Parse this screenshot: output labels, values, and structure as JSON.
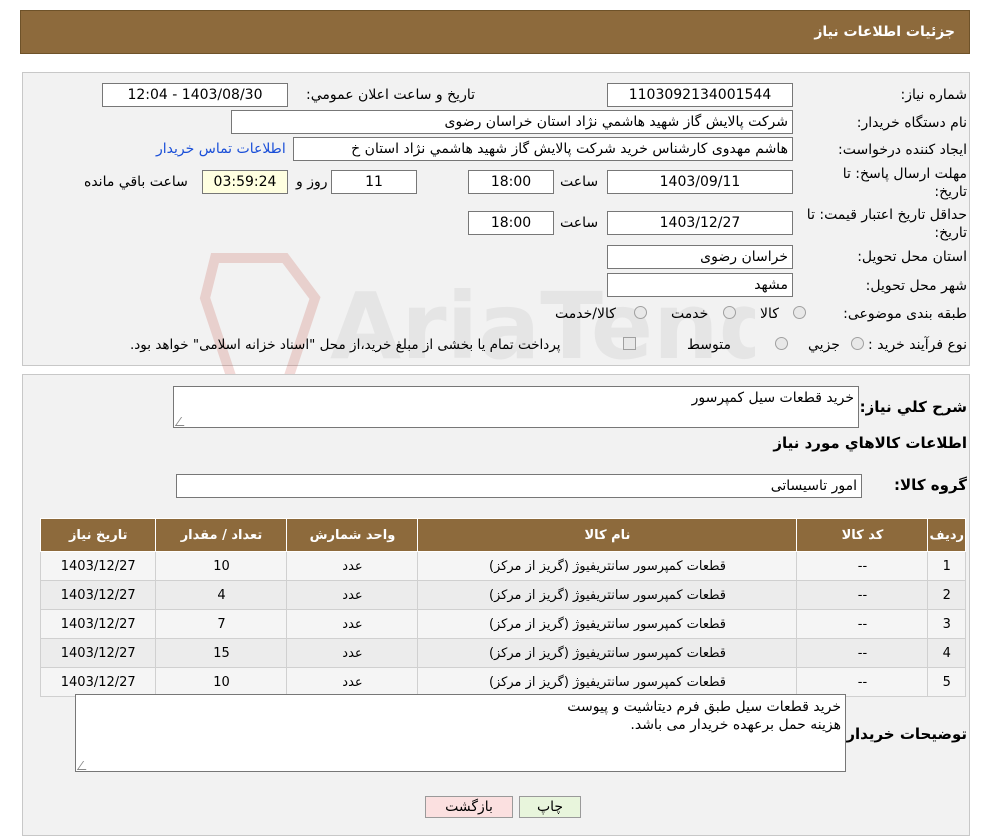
{
  "header": {
    "title": "جزئیات اطلاعات نیاز"
  },
  "form": {
    "need_number_label": "شماره نیاز:",
    "need_number": "1103092134001544",
    "announce_label": "تاریخ و ساعت اعلان عمومي:",
    "announce_value": "1403/08/30 - 12:04",
    "buyer_org_label": "نام دستگاه خريدار:",
    "buyer_org": "شرکت پالايش گاز شهيد هاشمي نژاد   استان خراسان رضوی",
    "creator_label": "ايجاد کننده درخواست:",
    "creator": "هاشم مهدوی کارشناس خرید شرکت پالايش گاز شهيد هاشمي نژاد   استان خ",
    "contact_link": "اطلاعات تماس خريدار",
    "deadline_label": "مهلت ارسال پاسخ: تا تاریخ:",
    "deadline_date": "1403/09/11",
    "time_label": "ساعت",
    "deadline_time": "18:00",
    "days_value": "11",
    "days_label": "روز و",
    "remaining_value": "03:59:24",
    "remaining_label": "ساعت باقي مانده",
    "validity_label": "حداقل تاريخ اعتبار قيمت: تا تاریخ:",
    "validity_date": "1403/12/27",
    "validity_time": "18:00",
    "province_label": "استان محل تحويل:",
    "province": "خراسان رضوی",
    "city_label": "شهر محل تحويل:",
    "city": "مشهد",
    "category_label": "طبقه بندی موضوعی:",
    "category_options": [
      "کالا",
      "خدمت",
      "کالا/خدمت"
    ],
    "purchase_type_label": "نوع فرآيند خريد :",
    "purchase_options": [
      "جزيي",
      "متوسط"
    ],
    "purchase_note": "پرداخت تمام يا بخشی از مبلغ خريد،از محل \"اسناد خزانه اسلامی\" خواهد بود."
  },
  "summary": {
    "label": "شرح کلي نياز:",
    "value": "خريد قطعات سيل کمپرسور"
  },
  "goods": {
    "section_title": "اطلاعات کالاهاي مورد نياز",
    "group_label": "گروه کالا:",
    "group_value": "امور تاسیساتی"
  },
  "table": {
    "headers": [
      "رديف",
      "کد کالا",
      "نام کالا",
      "واحد شمارش",
      "تعداد / مقدار",
      "تاريخ نياز"
    ],
    "rows": [
      [
        "1",
        "--",
        "قطعات کمپرسور سانتریفیوژ (گریز از مرکز)",
        "عدد",
        "10",
        "1403/12/27"
      ],
      [
        "2",
        "--",
        "قطعات کمپرسور سانتریفیوژ (گریز از مرکز)",
        "عدد",
        "4",
        "1403/12/27"
      ],
      [
        "3",
        "--",
        "قطعات کمپرسور سانتریفیوژ (گریز از مرکز)",
        "عدد",
        "7",
        "1403/12/27"
      ],
      [
        "4",
        "--",
        "قطعات کمپرسور سانتریفیوژ (گریز از مرکز)",
        "عدد",
        "15",
        "1403/12/27"
      ],
      [
        "5",
        "--",
        "قطعات کمپرسور سانتریفیوژ (گریز از مرکز)",
        "عدد",
        "10",
        "1403/12/27"
      ]
    ]
  },
  "buyer_notes": {
    "label": "توضيحات خريدار:",
    "line1": "خريد قطعات سيل طبق فرم ديتاشيت و پيوست",
    "line2": "هزينه حمل برعهده خريدار می باشد."
  },
  "buttons": {
    "print": "چاپ",
    "back": "بازگشت"
  },
  "watermark": {
    "text": "AriaTender.neT"
  }
}
